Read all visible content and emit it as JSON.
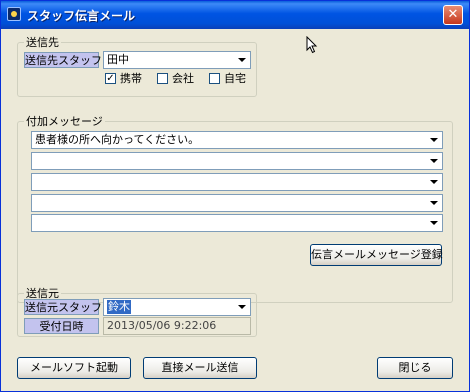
{
  "window": {
    "title": "スタッフ伝言メール",
    "close_label": "✕"
  },
  "recipient": {
    "legend": "送信先",
    "staff_label": "送信先スタッフ",
    "staff_value": "田中",
    "checkboxes": [
      {
        "label": "携帯",
        "checked": true
      },
      {
        "label": "会社",
        "checked": false
      },
      {
        "label": "自宅",
        "checked": false
      }
    ]
  },
  "message": {
    "legend": "付加メッセージ",
    "lines": [
      "患者様の所へ向かってください。",
      "",
      "",
      "",
      ""
    ],
    "register_button": "伝言メールメッセージ登録"
  },
  "sender": {
    "legend": "送信元",
    "staff_label": "送信元スタッフ",
    "staff_value": "鈴木",
    "date_label": "受付日時",
    "date_value": "2013/05/06 9:22:06"
  },
  "buttons": {
    "launch_mail": "メールソフト起動",
    "direct_send": "直接メール送信",
    "close": "閉じる"
  },
  "colors": {
    "titlebar": "#0054e3",
    "label_bg": "#c3c3ee",
    "window_bg": "#ece9d8"
  }
}
